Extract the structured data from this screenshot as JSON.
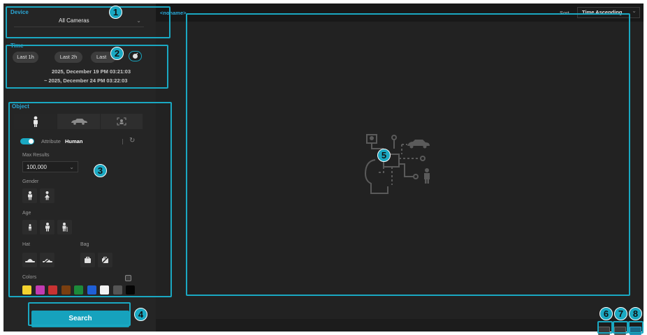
{
  "device": {
    "section_title": "Device",
    "selected_camera": "All Cameras"
  },
  "time": {
    "section_title": "Time",
    "presets": [
      "Last 1h",
      "Last 2h",
      "Last"
    ],
    "range_start": "2025, December 19 PM 03:21:03",
    "range_end": "~ 2025, December 24 PM 03:22:03"
  },
  "object": {
    "section_title": "Object",
    "tabs": [
      "person-tab",
      "vehicle-tab",
      "face-tab"
    ],
    "attribute_label": "Attribute",
    "attribute_value": "Human",
    "max_results_label": "Max Results",
    "max_results_value": "100,000",
    "gender_label": "Gender",
    "age_label": "Age",
    "hat_label": "Hat",
    "bag_label": "Bag",
    "colors_label": "Colors",
    "colors": [
      "#f2d22e",
      "#c23bb2",
      "#c83232",
      "#7a3f10",
      "#1c8a3a",
      "#1f5fd6",
      "#f2f2f2",
      "#555555",
      "#050505"
    ]
  },
  "search": {
    "button_label": "Search"
  },
  "header": {
    "channel_name": "<noname>",
    "sort_label": "Sort",
    "sort_value": "Time Ascending"
  },
  "callouts": [
    "1",
    "2",
    "3",
    "4",
    "5",
    "6",
    "7",
    "8"
  ],
  "accent_color": "#1aa8c2"
}
